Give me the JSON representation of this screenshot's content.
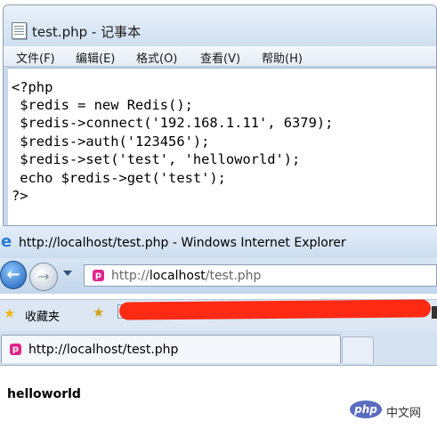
{
  "notepad": {
    "title": "test.php - 记事本",
    "menu": [
      {
        "label": "文件(F)"
      },
      {
        "label": "编辑(E)"
      },
      {
        "label": "格式(O)"
      },
      {
        "label": "查看(V)"
      },
      {
        "label": "帮助(H)"
      }
    ],
    "code_lines": [
      "<?php",
      " $redis = new Redis();",
      " $redis->connect('192.168.1.11', 6379);",
      " $redis->auth('123456');",
      " $redis->set('test', 'helloworld');",
      " echo $redis->get('test');",
      "?>"
    ]
  },
  "browser": {
    "title": "http://localhost/test.php - Windows Internet Explorer",
    "address_prefix": "http://",
    "address_host": "localhost",
    "address_path": "/test.php",
    "favorites_label": "收藏夹",
    "tab_label": "http://localhost/test.php",
    "page_output": "helloworld",
    "site_icon_glyph": "p",
    "brand_icon_glyph": "e",
    "icons": [
      "ie-logo-icon",
      "back-arrow-icon",
      "forward-arrow-icon",
      "star-icon",
      "add-favorite-icon",
      "site-favicon-icon"
    ]
  },
  "watermark": {
    "badge": "php",
    "text": "中文网"
  },
  "colors": {
    "redaction": "#ff2a14",
    "site_icon": "#e2248a",
    "ie_blue": "#2a7bd6"
  }
}
